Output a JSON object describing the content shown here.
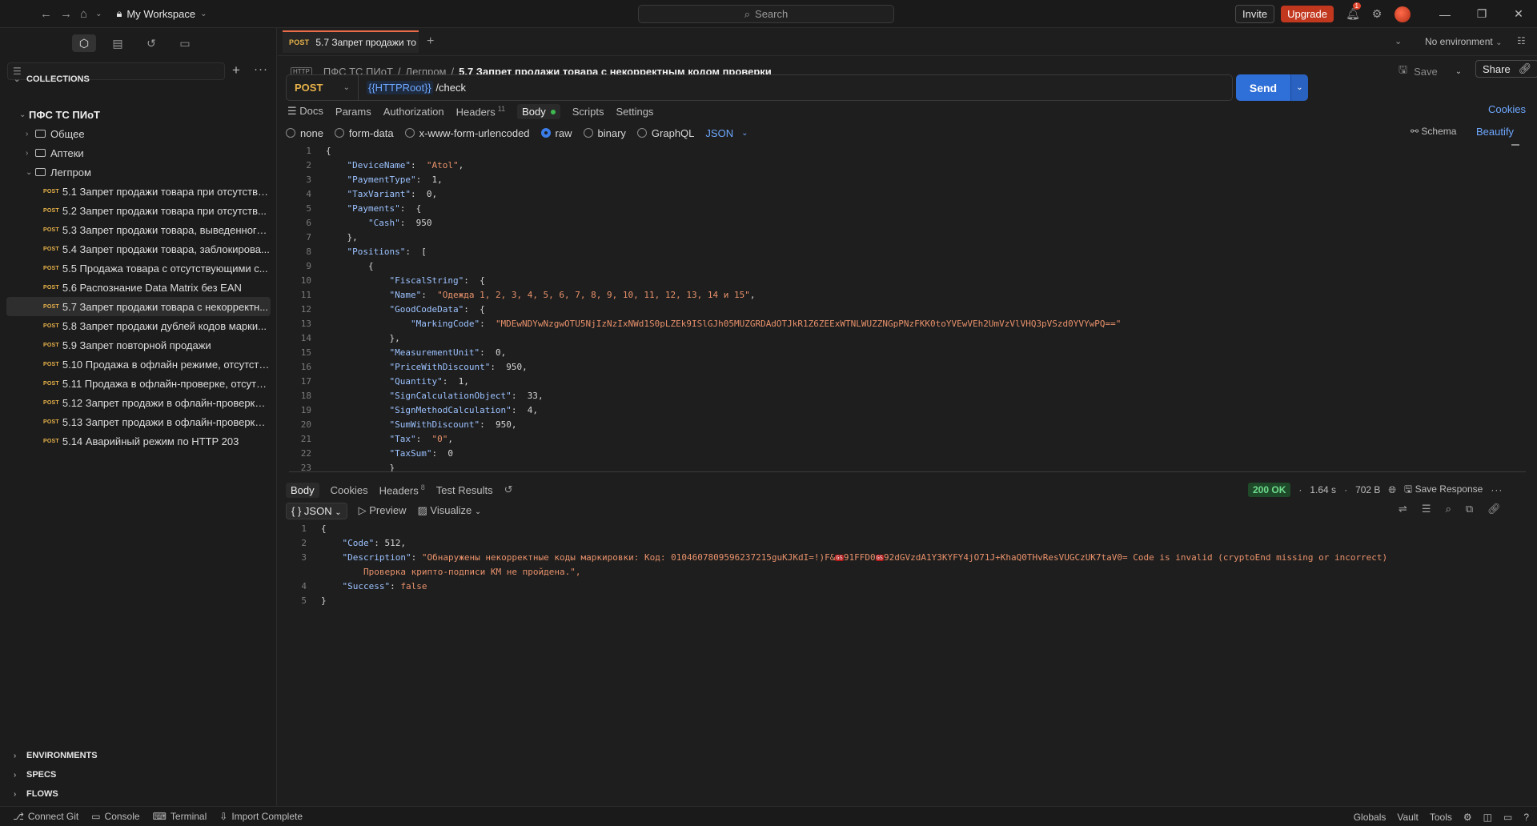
{
  "topbar": {
    "workspace": "My Workspace",
    "search_placeholder": "Search",
    "invite": "Invite",
    "upgrade": "Upgrade",
    "notifications_count": "1"
  },
  "sidebar": {
    "collections_label": "COLLECTIONS",
    "collection_name": "ПФС ТС ПИоТ",
    "folders": [
      "Общее",
      "Аптеки",
      "Легпром"
    ],
    "requests": [
      "5.1 Запрет продажи товара при отсутстви...",
      "5.2 Запрет продажи товара при отсутств...",
      "5.3 Запрет продажи товара, выведенного...",
      "5.4 Запрет продажи товара, заблокирова...",
      "5.5 Продажа товара с отсутствующими с...",
      "5.6 Распознание Data Matrix без EAN",
      "5.7 Запрет продажи товара с некорректн...",
      "5.8 Запрет продажи дублей кодов марки...",
      "5.9 Запрет повторной продажи",
      "5.10 Продажа в офлайн режиме, отсутств...",
      "5.11 Продажа в офлайн-проверке, отсутст...",
      "5.12 Запрет продажи в офлайн-проверке,...",
      "5.13 Запрет продажи в офлайн-проверке ...",
      "5.14 Аварийный режим по HTTP 203"
    ],
    "method_tag": "POST",
    "environments_label": "ENVIRONMENTS",
    "specs_label": "SPECS",
    "flows_label": "FLOWS"
  },
  "tab": {
    "method": "POST",
    "title": "5.7 Запрет продажи то",
    "environment": "No environment"
  },
  "breadcrumb": {
    "collection": "ПФС ТС ПИоТ",
    "folder": "Легпром",
    "current": "5.7 Запрет продажи товара с некорректным кодом проверки",
    "http_badge": "HTTP"
  },
  "actions": {
    "save": "Save",
    "share": "Share"
  },
  "request": {
    "method": "POST",
    "url_var": "{{HTTPRoot}}",
    "url_path": " /check",
    "send": "Send"
  },
  "req_tabs": {
    "docs": "Docs",
    "params": "Params",
    "authorization": "Authorization",
    "headers": "Headers",
    "headers_count": "11",
    "body": "Body",
    "scripts": "Scripts",
    "settings": "Settings",
    "cookies": "Cookies"
  },
  "body_types": {
    "none": "none",
    "form_data": "form-data",
    "urlencoded": "x-www-form-urlencoded",
    "raw": "raw",
    "binary": "binary",
    "graphql": "GraphQL",
    "json": "JSON",
    "schema": "Schema",
    "beautify": "Beautify"
  },
  "body_code": {
    "device_name": "\"Atol\"",
    "payment_type": "1",
    "tax_variant": "0",
    "cash": "950",
    "name": "\"Одежда 1, 2, 3, 4, 5, 6, 7, 8, 9, 10, 11, 12, 13, 14 и 15\"",
    "marking_code": "\"MDEwNDYwNzgwOTU5NjIzNzIxNWd1S0pLZEk9ISlGJh05MUZGRDAdOTJkR1Z6ZEExWTNLWUZZNGpPNzFKK0toYVEwVEh2UmVzVlVHQ3pVSzd0YVYwPQ==\"",
    "measurement_unit": "0",
    "price_with_discount": "950",
    "quantity": "1",
    "sign_calculation_object": "33",
    "sign_method_calculation": "4",
    "sum_with_discount": "950",
    "tax": "\"0\"",
    "tax_sum": "0"
  },
  "response": {
    "tabs": {
      "body": "Body",
      "cookies": "Cookies",
      "headers": "Headers",
      "headers_count": "8",
      "test_results": "Test Results"
    },
    "status": "200 OK",
    "time": "1.64 s",
    "size": "702 B",
    "save_response": "Save Response",
    "mode": "JSON",
    "preview": "Preview",
    "visualize": "Visualize",
    "code": "512",
    "description_part1": "\"Обнаружены некорректные коды маркировки: Код: 0104607809596237215guKJKdI=!)F&",
    "description_part2": "91FFD0",
    "description_part3": "92dGVzdA1Y3KYFY4jO71J+KhaQ0THvResVUGCzUK7taV0= Code is invalid (cryptoEnd missing or incorrect)",
    "description_line2": "Проверка крипто-подписи КМ не пройдена.\",",
    "gs": "GS",
    "success": "false"
  },
  "statusbar": {
    "connect_git": "Connect Git",
    "console": "Console",
    "terminal": "Terminal",
    "import_complete": "Import Complete",
    "globals": "Globals",
    "vault": "Vault",
    "tools": "Tools"
  }
}
